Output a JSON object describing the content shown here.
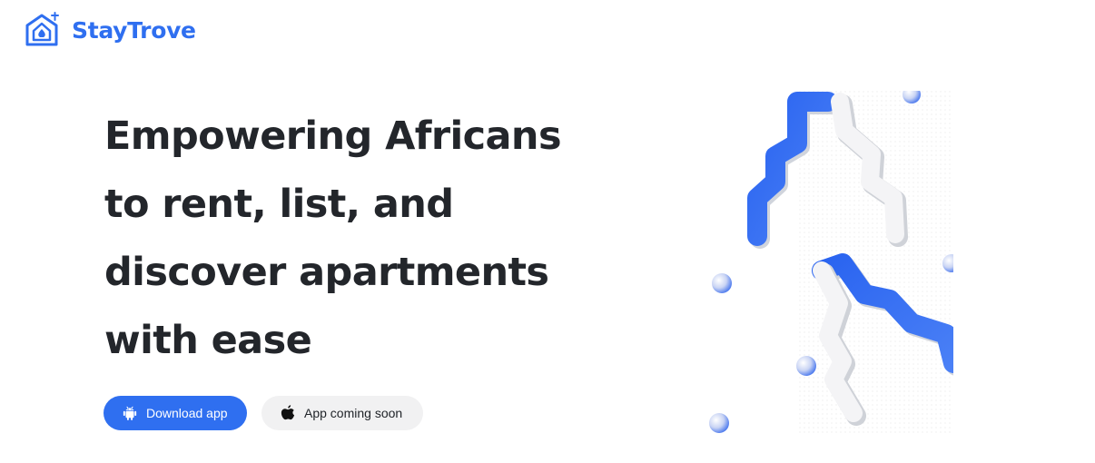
{
  "brand": {
    "name": "StayTrove",
    "logo_icon": "house-logo-icon",
    "color": "#2f6ff0"
  },
  "hero": {
    "headline_lines": [
      "Empowering Africans",
      "to rent, list, and",
      "discover apartments",
      "with ease"
    ]
  },
  "buttons": {
    "download": {
      "label": "Download app",
      "icon": "android-icon",
      "bg": "#2f6ff0"
    },
    "coming_soon": {
      "label": "App coming soon",
      "icon": "apple-icon",
      "bg": "#f1f1f2"
    }
  },
  "illustration": {
    "icon": "abstract-tubes-illustration",
    "accent": "#3b6ef2"
  }
}
